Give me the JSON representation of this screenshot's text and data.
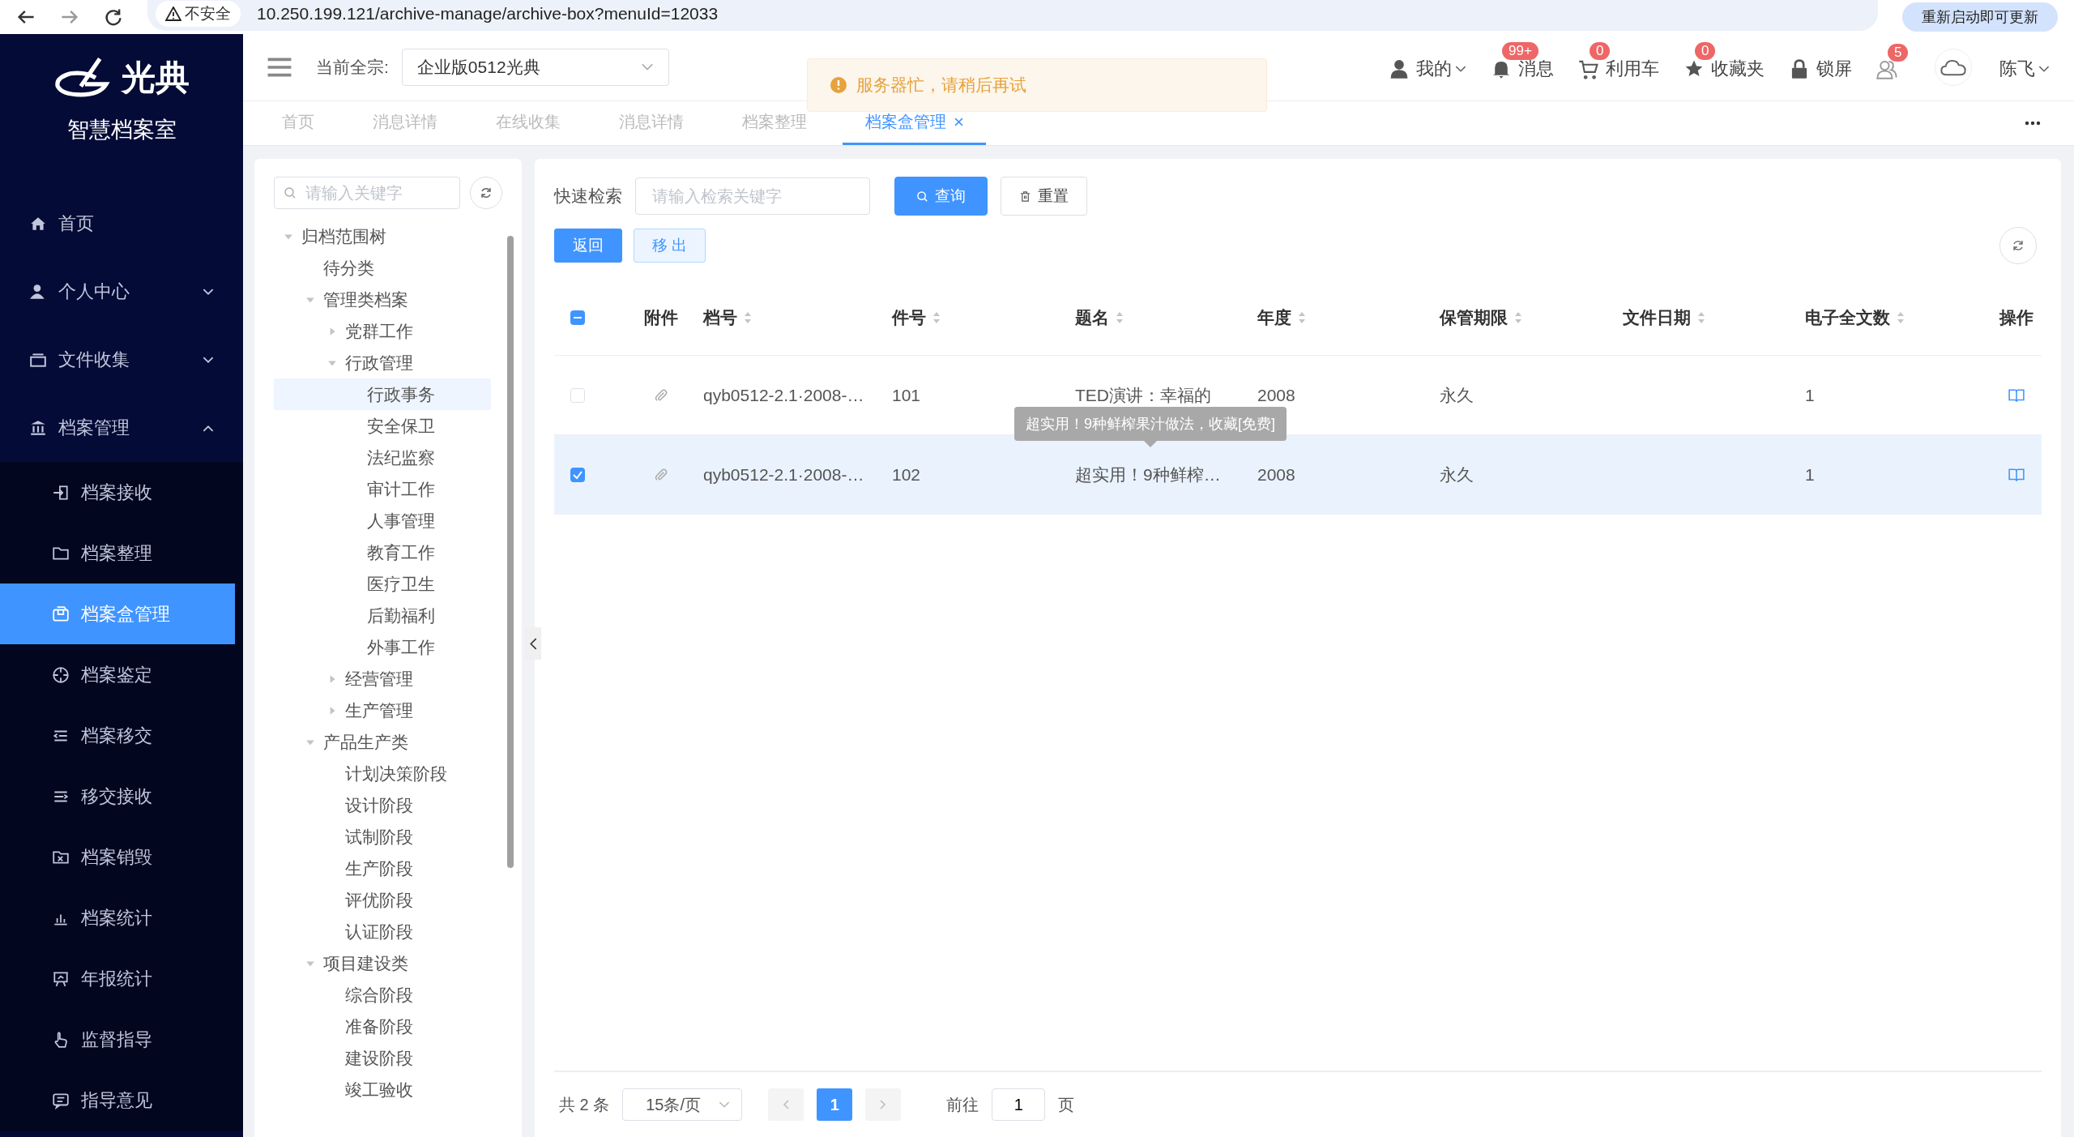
{
  "browser": {
    "security": "不安全",
    "url": "10.250.199.121/archive-manage/archive-box?menuId=12033",
    "update_button": "重新启动即可更新"
  },
  "sidebar": {
    "logo": "光典",
    "title": "智慧档案室",
    "items": [
      {
        "label": "首页",
        "selected": false
      },
      {
        "label": "个人中心",
        "selected": false,
        "expanded": false
      },
      {
        "label": "文件收集",
        "selected": false,
        "expanded": false
      },
      {
        "label": "档案管理",
        "selected": false,
        "expanded": true,
        "children": [
          {
            "label": "档案接收",
            "selected": false
          },
          {
            "label": "档案整理",
            "selected": false
          },
          {
            "label": "档案盒管理",
            "selected": true
          },
          {
            "label": "档案鉴定",
            "selected": false
          },
          {
            "label": "档案移交",
            "selected": false
          },
          {
            "label": "移交接收",
            "selected": false
          },
          {
            "label": "档案销毁",
            "selected": false
          },
          {
            "label": "档案统计",
            "selected": false
          },
          {
            "label": "年报统计",
            "selected": false
          },
          {
            "label": "监督指导",
            "selected": false
          },
          {
            "label": "指导意见",
            "selected": false
          }
        ]
      }
    ]
  },
  "header": {
    "org_label": "当前全宗:",
    "org_value": "企业版0512光典",
    "actions": [
      {
        "label": "我的",
        "dropdown": true
      },
      {
        "label": "消息",
        "badge": "99+",
        "dropdown": false
      },
      {
        "label": "利用车",
        "badge": "0",
        "dropdown": false
      },
      {
        "label": "收藏夹",
        "badge": "0",
        "dropdown": false
      },
      {
        "label": "锁屏",
        "dropdown": false
      },
      {
        "badge": "5",
        "dropdown": false
      }
    ],
    "user": "陈飞"
  },
  "toast": {
    "message": "服务器忙，请稍后再试"
  },
  "tabs": [
    {
      "label": "首页",
      "selected": false,
      "closable": false
    },
    {
      "label": "消息详情",
      "selected": false,
      "closable": false
    },
    {
      "label": "在线收集",
      "selected": false,
      "closable": false
    },
    {
      "label": "消息详情",
      "selected": false,
      "closable": false
    },
    {
      "label": "档案整理",
      "selected": false,
      "closable": false
    },
    {
      "label": "档案盒管理",
      "selected": true,
      "closable": true
    }
  ],
  "tree": {
    "search_placeholder": "请输入关键字",
    "nodes": [
      {
        "label": "归档范围树",
        "selected": false,
        "expanded": true,
        "children": [
          {
            "label": "待分类",
            "selected": false
          },
          {
            "label": "管理类档案",
            "selected": false,
            "expanded": true,
            "children": [
              {
                "label": "党群工作",
                "selected": false,
                "expanded": false
              },
              {
                "label": "行政管理",
                "selected": false,
                "expanded": true,
                "children": [
                  {
                    "label": "行政事务",
                    "selected": true
                  },
                  {
                    "label": "安全保卫",
                    "selected": false
                  },
                  {
                    "label": "法纪监察",
                    "selected": false
                  },
                  {
                    "label": "审计工作",
                    "selected": false
                  },
                  {
                    "label": "人事管理",
                    "selected": false
                  },
                  {
                    "label": "教育工作",
                    "selected": false
                  },
                  {
                    "label": "医疗卫生",
                    "selected": false
                  },
                  {
                    "label": "后勤福利",
                    "selected": false
                  },
                  {
                    "label": "外事工作",
                    "selected": false
                  }
                ]
              },
              {
                "label": "经营管理",
                "selected": false,
                "expanded": false
              },
              {
                "label": "生产管理",
                "selected": false,
                "expanded": false
              }
            ]
          },
          {
            "label": "产品生产类",
            "selected": false,
            "expanded": true,
            "children": [
              {
                "label": "计划决策阶段",
                "selected": false
              },
              {
                "label": "设计阶段",
                "selected": false
              },
              {
                "label": "试制阶段",
                "selected": false
              },
              {
                "label": "生产阶段",
                "selected": false
              },
              {
                "label": "评优阶段",
                "selected": false
              },
              {
                "label": "认证阶段",
                "selected": false
              }
            ]
          },
          {
            "label": "项目建设类",
            "selected": false,
            "expanded": true,
            "children": [
              {
                "label": "综合阶段",
                "selected": false
              },
              {
                "label": "准备阶段",
                "selected": false
              },
              {
                "label": "建设阶段",
                "selected": false
              },
              {
                "label": "竣工验收",
                "selected": false
              }
            ]
          }
        ]
      }
    ]
  },
  "search": {
    "label": "快速检索",
    "placeholder": "请输入检索关键字",
    "query_button": "查询",
    "reset_button": "重置"
  },
  "actions": [
    {
      "label": "返回",
      "kind": "primary"
    },
    {
      "label": "移 出",
      "kind": "plain"
    }
  ],
  "table": {
    "select_all": {
      "checked": false,
      "indeterminate": true
    },
    "columns": [
      {
        "label": "附件",
        "sortable": false
      },
      {
        "label": "档号",
        "sortable": true
      },
      {
        "label": "件号",
        "sortable": true
      },
      {
        "label": "题名",
        "sortable": true
      },
      {
        "label": "年度",
        "sortable": true
      },
      {
        "label": "保管期限",
        "sortable": true
      },
      {
        "label": "文件日期",
        "sortable": true
      },
      {
        "label": "电子全文数",
        "sortable": true
      },
      {
        "label": "操作",
        "sortable": false
      }
    ],
    "rows": [
      {
        "checked": false,
        "code": "qyb0512-2.1·2008-…",
        "number": "101",
        "title": "TED演讲：幸福的",
        "year": "2008",
        "retention": "永久",
        "files": "1"
      },
      {
        "checked": true,
        "code": "qyb0512-2.1·2008-…",
        "number": "102",
        "title": "超实用！9种鲜榨…",
        "year": "2008",
        "retention": "永久",
        "files": "1"
      }
    ],
    "tooltip": "超实用！9种鲜榨果汁做法，收藏[免费]"
  },
  "pagination": {
    "total": "共 2 条",
    "page_size": "15条/页",
    "pages": [
      {
        "label": "1",
        "selected": true
      }
    ],
    "goto_label": "前往",
    "goto_value": "1",
    "page_unit": "页"
  }
}
